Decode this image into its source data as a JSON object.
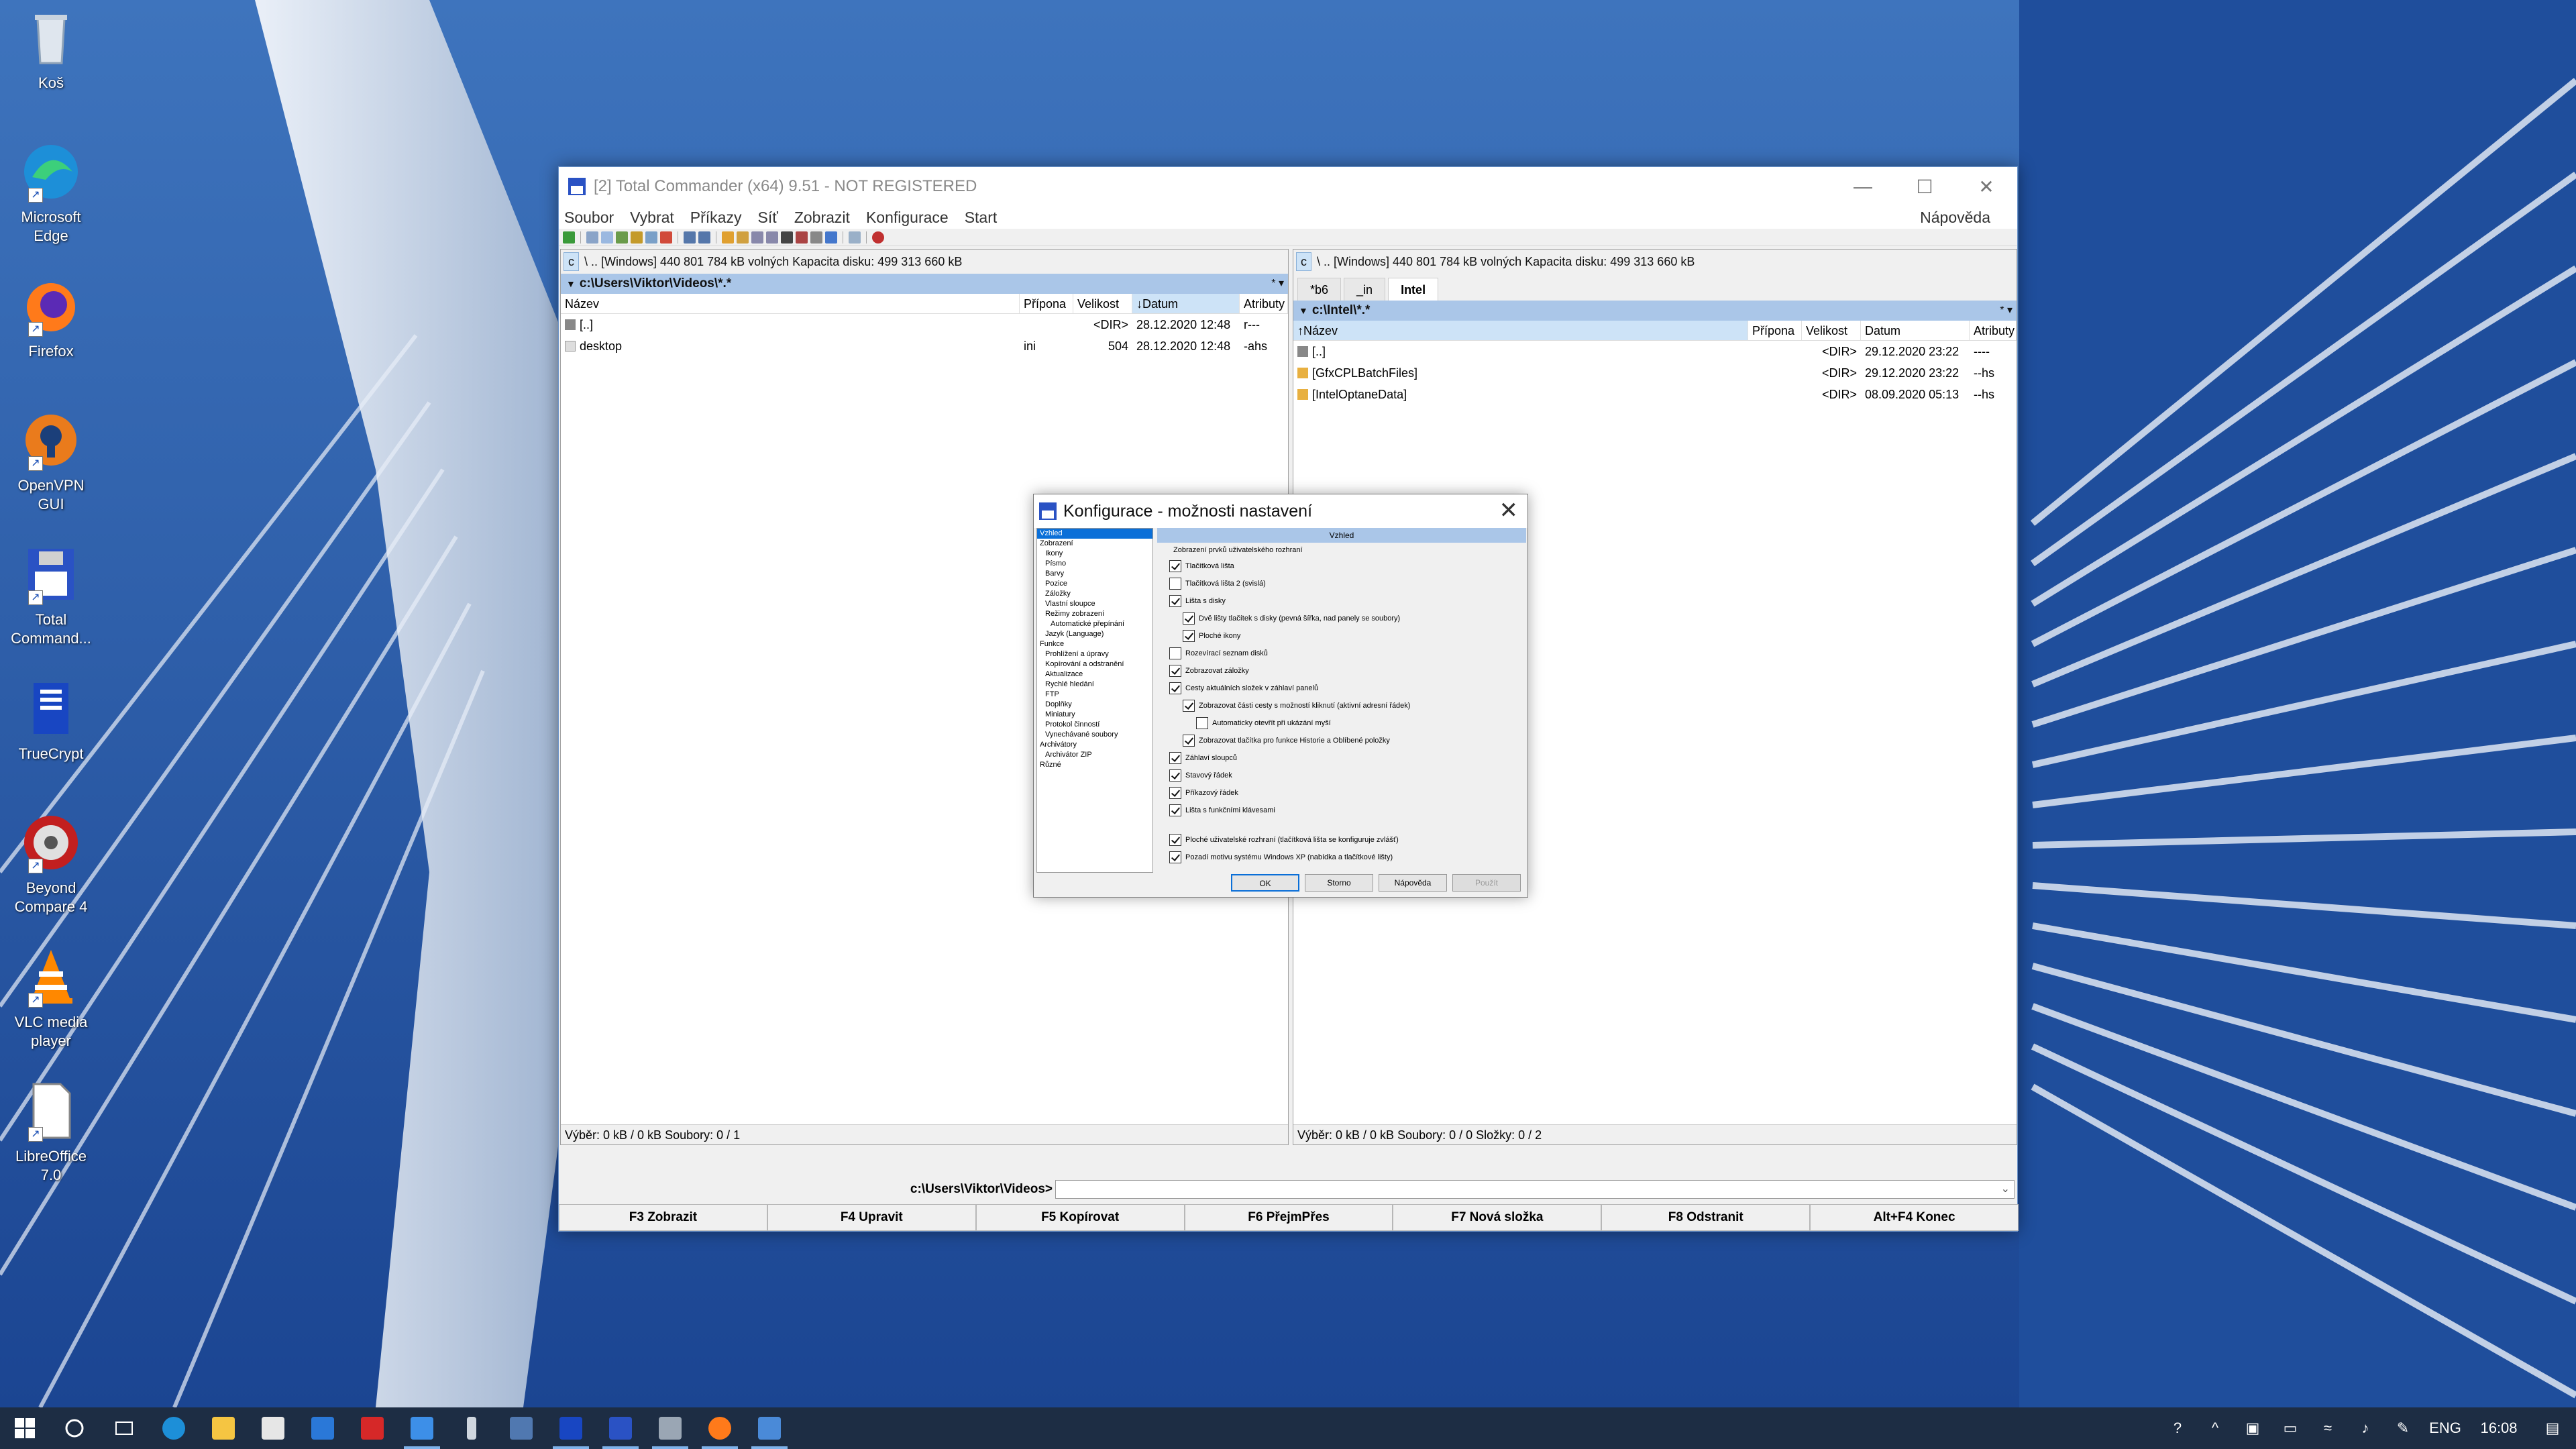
{
  "desktop": {
    "icons": [
      {
        "label": "Koš",
        "icon": "recycle-bin-icon"
      },
      {
        "label": "Microsoft Edge",
        "icon": "edge-icon"
      },
      {
        "label": "Firefox",
        "icon": "firefox-icon"
      },
      {
        "label": "OpenVPN GUI",
        "icon": "openvpn-icon"
      },
      {
        "label": "Total Command...",
        "icon": "total-commander-icon"
      },
      {
        "label": "TrueCrypt",
        "icon": "truecrypt-icon"
      },
      {
        "label": "Beyond Compare 4",
        "icon": "beyond-compare-icon"
      },
      {
        "label": "VLC media player",
        "icon": "vlc-icon"
      },
      {
        "label": "LibreOffice 7.0",
        "icon": "libreoffice-icon"
      }
    ]
  },
  "window": {
    "title": "[2] Total Commander (x64) 9.51 - NOT REGISTERED",
    "menu": [
      "Soubor",
      "Vybrat",
      "Příkazy",
      "Síť",
      "Zobrazit",
      "Konfigurace",
      "Start"
    ],
    "help": "Nápověda"
  },
  "left_panel": {
    "drive": "c",
    "drive_info": "\\  ..  [Windows]  440 801 784 kB volných  Kapacita disku: 499 313 660 kB",
    "path": "c:\\Users\\Viktor\\Videos\\*.*",
    "star": "* ▾",
    "columns": [
      "Název",
      "Přípona",
      "Velikost",
      "Datum",
      "Atributy"
    ],
    "rows": [
      {
        "name": "[..]",
        "ext": "",
        "size": "<DIR>",
        "date": "28.12.2020 12:48",
        "attr": "r---"
      },
      {
        "name": "desktop",
        "ext": "ini",
        "size": "504",
        "date": "28.12.2020 12:48",
        "attr": "-ahs"
      }
    ],
    "status": "Výběr: 0 kB / 0 kB  Soubory: 0 / 1"
  },
  "right_panel": {
    "drive": "c",
    "drive_info": "\\  ..  [Windows]  440 801 784 kB volných  Kapacita disku: 499 313 660 kB",
    "tabs": [
      "*b6",
      "_in",
      "Intel"
    ],
    "path": "c:\\Intel\\*.*",
    "star": "* ▾",
    "columns": [
      "Název",
      "Přípona",
      "Velikost",
      "Datum",
      "Atributy"
    ],
    "rows": [
      {
        "name": "[..]",
        "ext": "",
        "size": "<DIR>",
        "date": "29.12.2020 23:22",
        "attr": "----"
      },
      {
        "name": "[GfxCPLBatchFiles]",
        "ext": "",
        "size": "<DIR>",
        "date": "29.12.2020 23:22",
        "attr": "--hs"
      },
      {
        "name": "[IntelOptaneData]",
        "ext": "",
        "size": "<DIR>",
        "date": "08.09.2020 05:13",
        "attr": "--hs"
      }
    ],
    "status": "Výběr: 0 kB / 0 kB  Soubory: 0 / 0  Složky: 0 / 2"
  },
  "cmdline": {
    "prompt": "c:\\Users\\Viktor\\Videos>",
    "dropdown": "⌄"
  },
  "fkeys": [
    "F3 Zobrazit",
    "F4 Upravit",
    "F5 Kopírovat",
    "F6 PřejmPřes",
    "F7 Nová složka",
    "F8 Odstranit",
    "Alt+F4 Konec"
  ],
  "dialog": {
    "title": "Konfigurace - možnosti nastavení",
    "close": "✕",
    "tree": [
      {
        "label": "Vzhled",
        "level": 0,
        "selected": true
      },
      {
        "label": "Zobrazení",
        "level": 0
      },
      {
        "label": "Ikony",
        "level": 1
      },
      {
        "label": "Písmo",
        "level": 1
      },
      {
        "label": "Barvy",
        "level": 1
      },
      {
        "label": "Pozice",
        "level": 1
      },
      {
        "label": "Záložky",
        "level": 1
      },
      {
        "label": "Vlastní sloupce",
        "level": 1
      },
      {
        "label": "Režimy zobrazení",
        "level": 1
      },
      {
        "label": "Automatické přepínání",
        "level": 2
      },
      {
        "label": "Jazyk (Language)",
        "level": 1
      },
      {
        "label": "Funkce",
        "level": 0
      },
      {
        "label": "Prohlížení a úpravy",
        "level": 1
      },
      {
        "label": "Kopírování a odstranění",
        "level": 1
      },
      {
        "label": "Aktualizace",
        "level": 1
      },
      {
        "label": "Rychlé hledání",
        "level": 1
      },
      {
        "label": "FTP",
        "level": 1
      },
      {
        "label": "Doplňky",
        "level": 1
      },
      {
        "label": "Miniatury",
        "level": 1
      },
      {
        "label": "Protokol činností",
        "level": 1
      },
      {
        "label": "Vynechávané soubory",
        "level": 1
      },
      {
        "label": "Archivátory",
        "level": 0
      },
      {
        "label": "Archivátor ZIP",
        "level": 1
      },
      {
        "label": "Různé",
        "level": 0
      }
    ],
    "header": "Vzhled",
    "group_label": "Zobrazení prvků uživatelského rozhraní",
    "options": [
      {
        "label": "Tlačítková lišta",
        "checked": true,
        "indent": 0
      },
      {
        "label": "Tlačítková lišta 2 (svislá)",
        "checked": false,
        "indent": 0
      },
      {
        "label": "Lišta s disky",
        "checked": true,
        "indent": 0
      },
      {
        "label": "Dvě lišty tlačítek s disky (pevná šířka, nad panely se soubory)",
        "checked": true,
        "indent": 1
      },
      {
        "label": "Ploché ikony",
        "checked": true,
        "indent": 1
      },
      {
        "label": "Rozevírací seznam disků",
        "checked": false,
        "indent": 0
      },
      {
        "label": "Zobrazovat záložky",
        "checked": true,
        "indent": 0
      },
      {
        "label": "Cesty aktuálních složek v záhlaví panelů",
        "checked": true,
        "indent": 0
      },
      {
        "label": "Zobrazovat části cesty s možností kliknutí (aktivní adresní řádek)",
        "checked": true,
        "indent": 1
      },
      {
        "label": "Automaticky otevřít při ukázání myší",
        "checked": false,
        "indent": 2
      },
      {
        "label": "Zobrazovat tlačítka pro funkce Historie a Oblíbené položky",
        "checked": true,
        "indent": 1
      },
      {
        "label": "Záhlaví sloupců",
        "checked": true,
        "indent": 0
      },
      {
        "label": "Stavový řádek",
        "checked": true,
        "indent": 0
      },
      {
        "label": "Příkazový řádek",
        "checked": true,
        "indent": 0
      },
      {
        "label": "Lišta s funkčními klávesami",
        "checked": true,
        "indent": 0
      }
    ],
    "bottom_options": [
      {
        "label": "Ploché uživatelské rozhraní (tlačítková lišta se konfiguruje zvlášť)",
        "checked": true
      },
      {
        "label": "Pozadí motivu systému Windows XP (nabídka a tlačítkové lišty)",
        "checked": true
      }
    ],
    "buttons": {
      "ok": "OK",
      "cancel": "Storno",
      "help": "Nápověda",
      "apply": "Použít"
    }
  },
  "taskbar": {
    "apps": [
      "windows-start-icon",
      "search-circle-icon",
      "task-view-icon",
      "edge-icon",
      "file-explorer-icon",
      "store-icon",
      "mail-icon",
      "app-red-icon",
      "dropbox-icon",
      "lightning-icon",
      "vm-icon",
      "truecrypt-icon",
      "total-commander-icon",
      "drive-icon",
      "firefox-icon",
      "document-icon"
    ],
    "tray": {
      "lang": "ENG",
      "time": "16:08"
    }
  },
  "colors": {
    "accent": "#0a6fd8",
    "path_bar": "#aac6e8",
    "taskbar": "#1d2d44"
  }
}
